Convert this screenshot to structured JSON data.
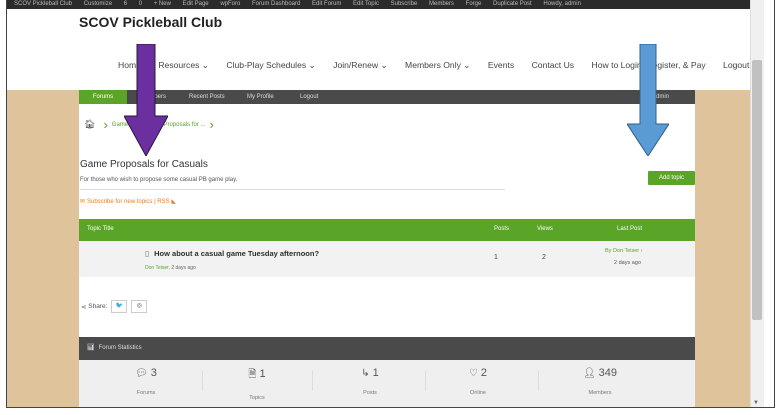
{
  "adminbar": {
    "items": [
      "SCOV Pickleball Club",
      "Customize",
      "6",
      "0",
      "+ New",
      "Edit Page",
      "wpForo",
      "Forum Dashboard",
      "Edit Forum",
      "Edit Topic",
      "Subscribe",
      "Members",
      "Forge",
      "Duplicate Post",
      "Howdy, admin"
    ]
  },
  "site": {
    "title": "SCOV Pickleball Club"
  },
  "nav": {
    "items": [
      "Home",
      "Resources ⌄",
      "Club-Play Schedules ⌄",
      "Join/Renew ⌄",
      "Members Only ⌄",
      "Events",
      "Contact Us",
      "How to Login, Register, & Pay",
      "Logout"
    ]
  },
  "forum_bar": {
    "forums": "Forums",
    "members": "Members",
    "recent_posts": "Recent Posts",
    "my_profile": "My Profile",
    "logout": "Logout",
    "right": "Admin"
  },
  "breadcrumb": {
    "home_icon": "home-icon",
    "level1": "Game...",
    "level2": "Game Proposals for ..."
  },
  "forum": {
    "title": "Game Proposals for Casuals",
    "description": "For those who wish to propose some casual PB game play.",
    "subscribe": "Subscribe for new topics",
    "rss": "| RSS",
    "add_topic": "Add topic"
  },
  "table": {
    "headers": {
      "topic_title": "Topic Title",
      "posts": "Posts",
      "views": "Views",
      "last_post": "Last Post"
    },
    "rows": [
      {
        "title": "How about a casual game Tuesday afternoon?",
        "author": "Don Teiser",
        "ago": ", 2 days ago",
        "posts": "1",
        "views": "2",
        "last_by": "By Don Teiser",
        "last_ago": "2 days ago"
      }
    ]
  },
  "share": {
    "label": "Share:",
    "twitter": "🐦",
    "whatsapp": "◎"
  },
  "stats": {
    "title": "Forum Statistics",
    "items": [
      {
        "value": "3",
        "label": "Forums",
        "icon": "comments-icon"
      },
      {
        "value": "1",
        "label": "Topics",
        "icon": "file-icon"
      },
      {
        "value": "1",
        "label": "Posts",
        "icon": "reply-icon"
      },
      {
        "value": "2",
        "label": "Online",
        "icon": "lightbulb-icon"
      },
      {
        "value": "349",
        "label": "Members",
        "icon": "user-icon"
      }
    ]
  },
  "colors": {
    "accent_green": "#5aa427",
    "annotation_purple": "#6b2fa0",
    "annotation_blue": "#5b9bd5",
    "tan": "#dfc39b"
  }
}
